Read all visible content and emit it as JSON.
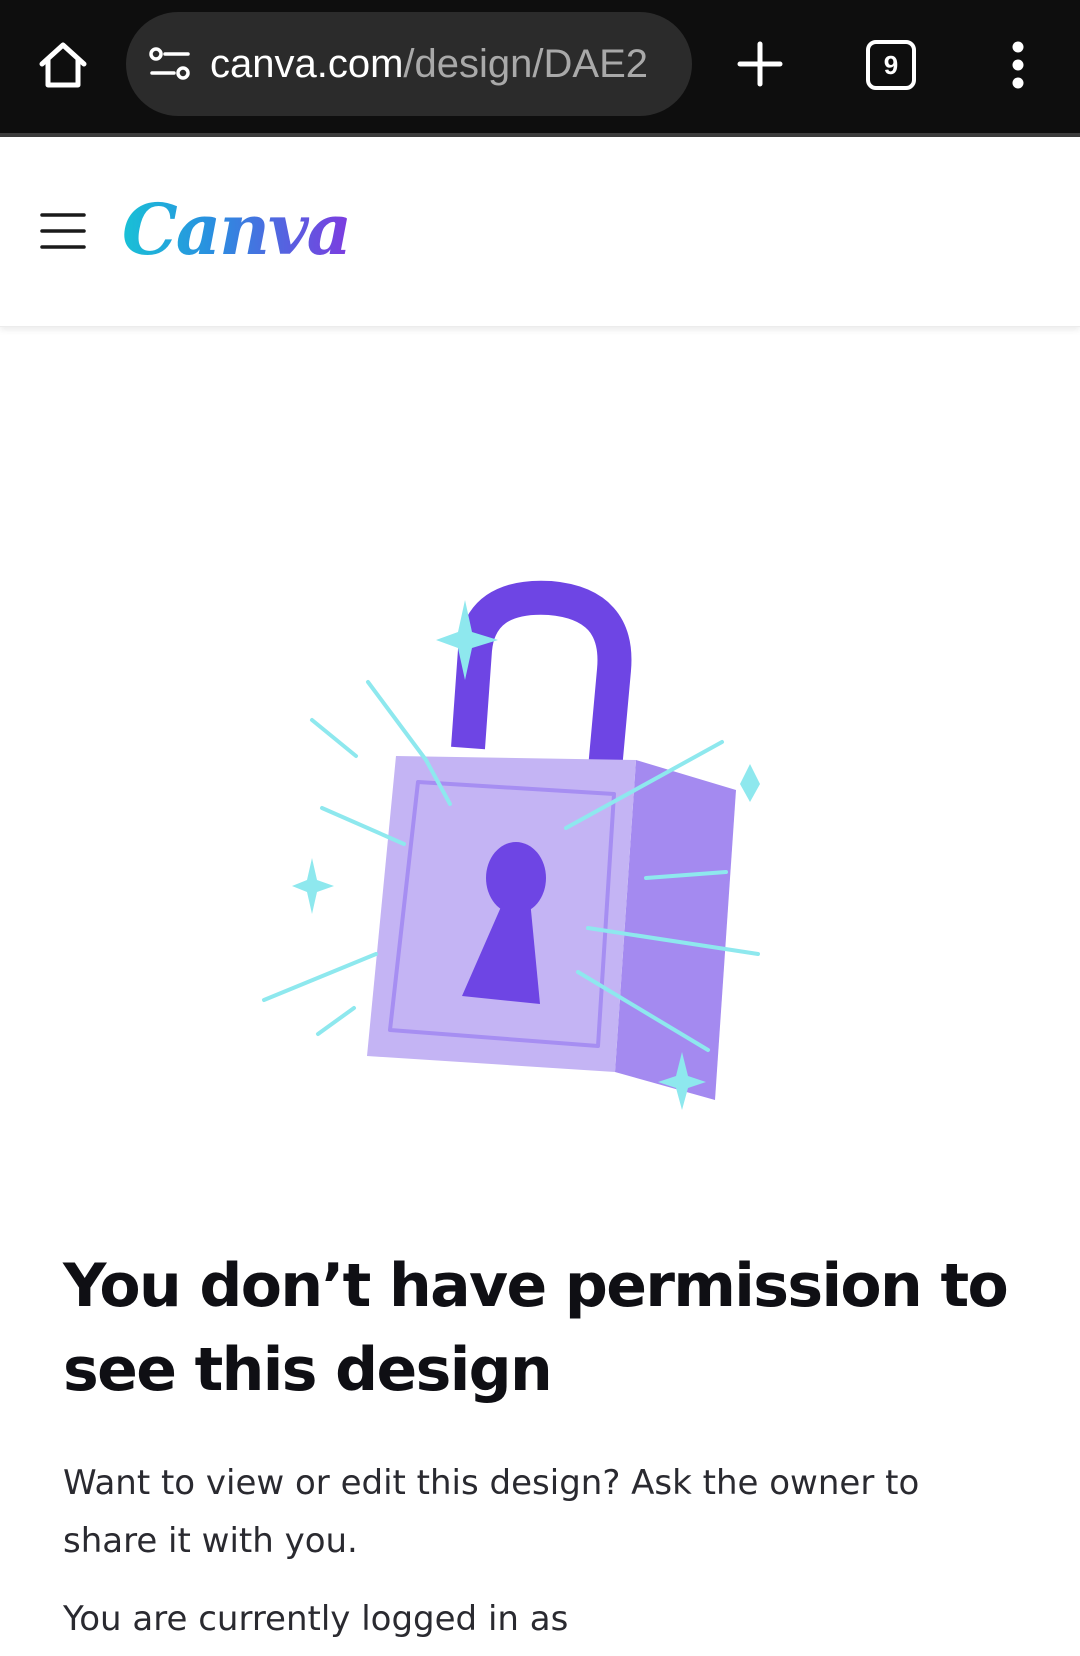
{
  "browser": {
    "url_domain": "canva.com",
    "url_path": "/design/DAE2",
    "tab_count": "9",
    "icons": [
      "home-icon",
      "site-info-icon",
      "new-tab-icon",
      "tab-switcher-icon",
      "more-menu-icon"
    ]
  },
  "header": {
    "logo_text": "Canva",
    "menu_icon": "hamburger-menu-icon"
  },
  "main": {
    "illustration": "padlock-illustration",
    "title": "You don’t have permission to see this design",
    "description": "Want to view or edit this design? Ask the owner to share it with you.",
    "login_status": "You are currently logged in as"
  },
  "colors": {
    "chrome_bg": "#0e0e0e",
    "lock_body": "#c4b4f4",
    "lock_side": "#a48af0",
    "lock_shackle": "#6e45e4",
    "sparkle": "#8ee8ee",
    "title_text": "#0f0f14"
  }
}
